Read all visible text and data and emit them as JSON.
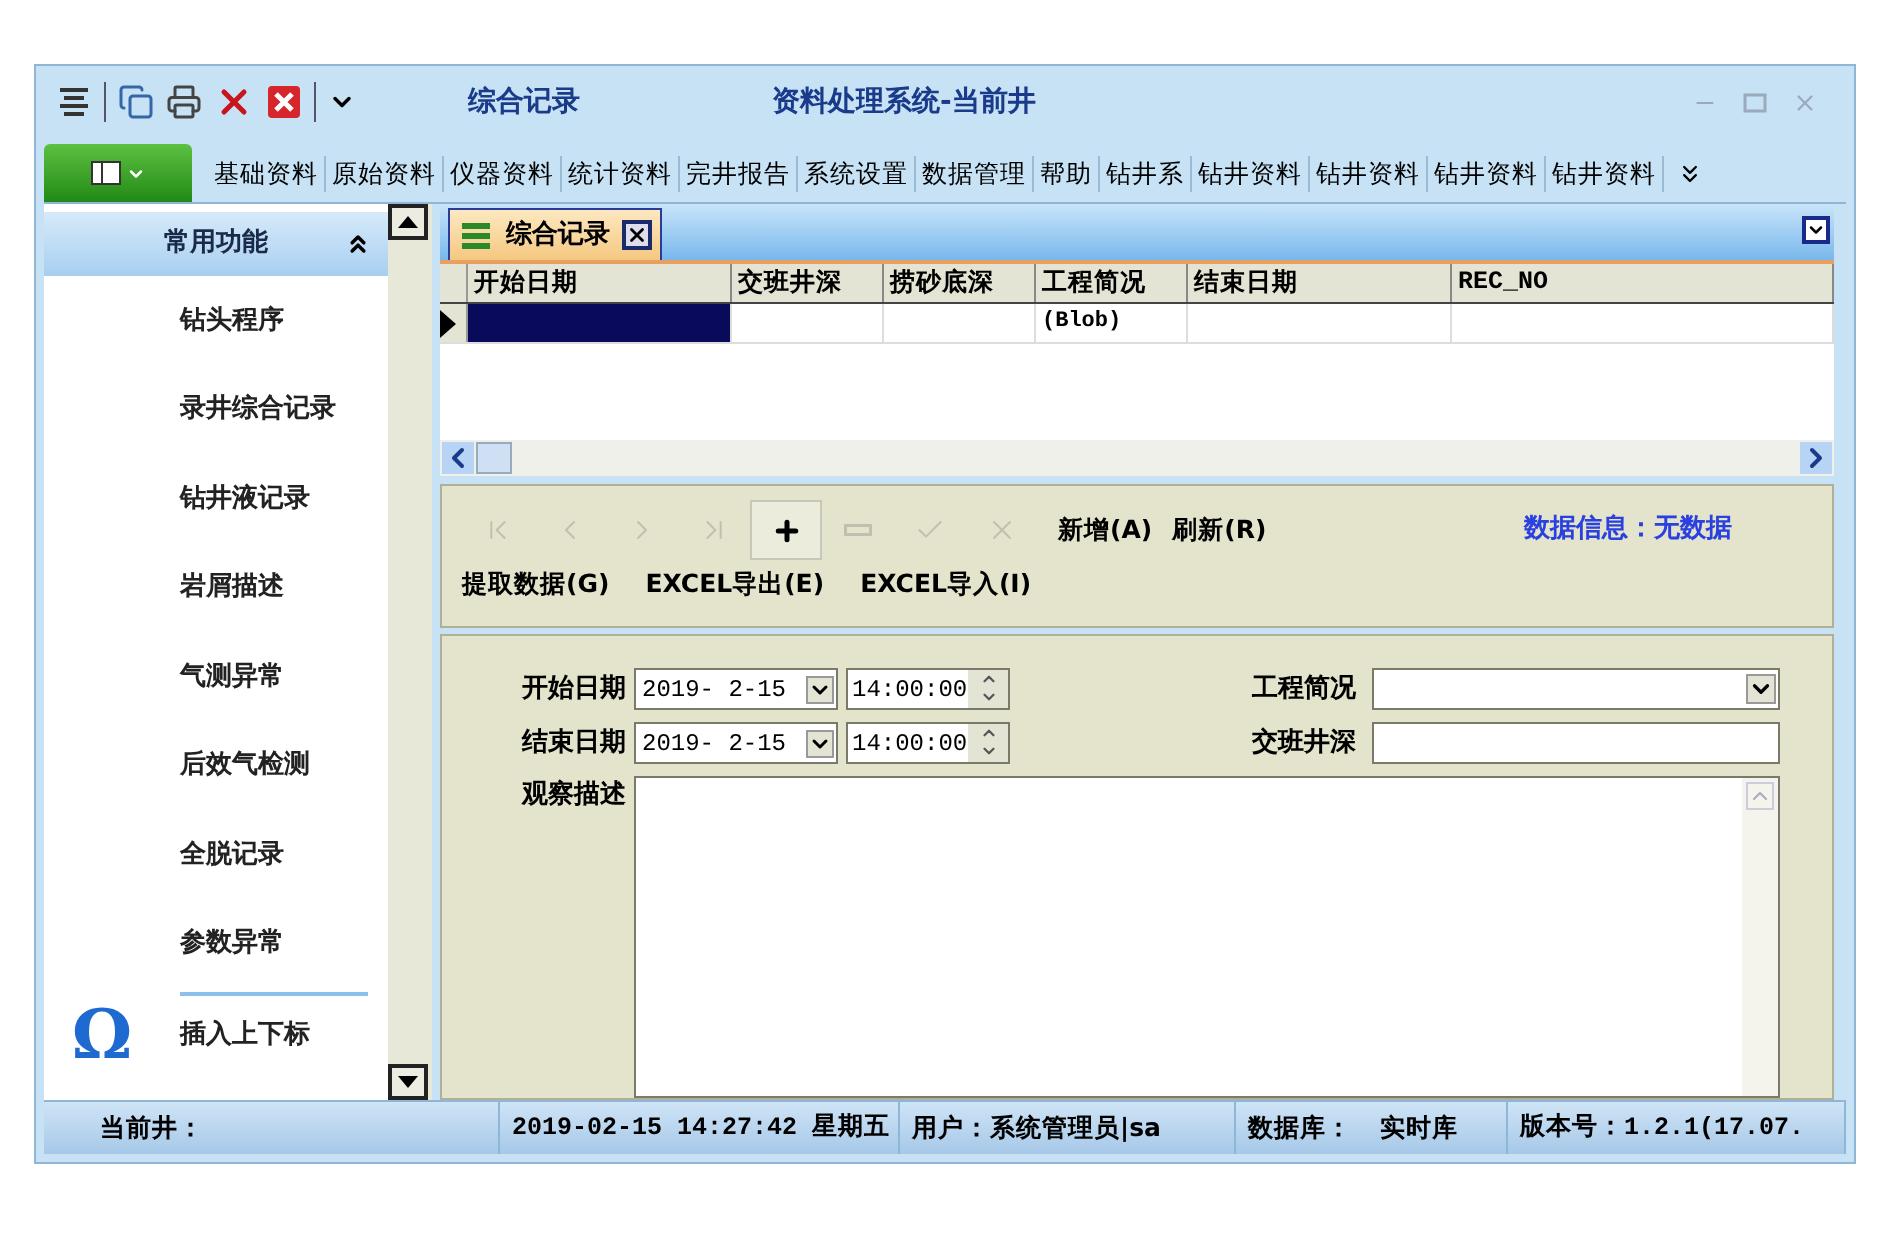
{
  "window": {
    "document_title": "综合记录",
    "title": "资料处理系统-当前井"
  },
  "menu": {
    "items": [
      "基础资料",
      "原始资料",
      "仪器资料",
      "统计资料",
      "完井报告",
      "系统设置",
      "数据管理",
      "帮助",
      "钻井系",
      "钻井资料",
      "钻井资料",
      "钻井资料",
      "钻井资料"
    ]
  },
  "sidebar": {
    "header": "常用功能",
    "expanded": true,
    "items": [
      {
        "label": "钻头程序",
        "kind": "plain"
      },
      {
        "label": "录井综合记录",
        "kind": "plain"
      },
      {
        "label": "钻井液记录",
        "kind": "plain"
      },
      {
        "label": "岩屑描述",
        "kind": "plain"
      },
      {
        "label": "气测异常",
        "kind": "plain"
      },
      {
        "label": "后效气检测",
        "kind": "plain"
      },
      {
        "label": "全脱记录",
        "kind": "plain"
      },
      {
        "label": "参数异常",
        "kind": "plain"
      },
      {
        "label": "插入上下标",
        "kind": "omega",
        "glyph": "Ω"
      }
    ]
  },
  "tabs": [
    {
      "label": "综合记录",
      "selected": true
    }
  ],
  "grid": {
    "columns": [
      "开始日期",
      "交班井深",
      "捞砂底深",
      "工程简况",
      "结束日期",
      "REC_NO"
    ],
    "rows": [
      {
        "selected": true,
        "cells": [
          {
            "focused": true
          },
          {
            "focused": false
          },
          {
            "focused": false
          },
          {
            "focused": false,
            "text": "(Blob)"
          },
          {
            "focused": false
          },
          {
            "focused": false
          }
        ]
      }
    ]
  },
  "navigator": {
    "buttons": [
      {
        "kind": "first",
        "disabled": true
      },
      {
        "kind": "prior",
        "disabled": true
      },
      {
        "kind": "next",
        "disabled": true
      },
      {
        "kind": "last",
        "disabled": true
      },
      {
        "kind": "insert",
        "disabled": false
      },
      {
        "kind": "delete",
        "disabled": true
      },
      {
        "kind": "post",
        "disabled": true
      },
      {
        "kind": "cancel",
        "disabled": true
      }
    ],
    "actions": [
      "新增(A)",
      "刷新(R)"
    ],
    "info": "数据信息：无数据",
    "tools": [
      "提取数据(G)",
      "EXCEL导出(E)",
      "EXCEL导入(I)"
    ]
  },
  "form": {
    "start": {
      "label": "开始日期",
      "date": "2019- 2-15",
      "time": "14:00:00"
    },
    "end": {
      "label": "结束日期",
      "date": "2019- 2-15",
      "time": "14:00:00"
    },
    "engineering": {
      "label": "工程简况"
    },
    "shift_depth": {
      "label": "交班井深"
    },
    "description": {
      "label": "观察描述"
    }
  },
  "status_bar": [
    {
      "texts": [
        "当前井："
      ]
    },
    {
      "texts": [
        "2019-02-15 14:27:42 星期五"
      ]
    },
    {
      "texts": [
        "用户：系统管理员|sa"
      ]
    },
    {
      "texts": [
        "数据库：",
        "实时库"
      ]
    },
    {
      "texts": [
        "版本号：1.2.1(17.07."
      ]
    }
  ]
}
